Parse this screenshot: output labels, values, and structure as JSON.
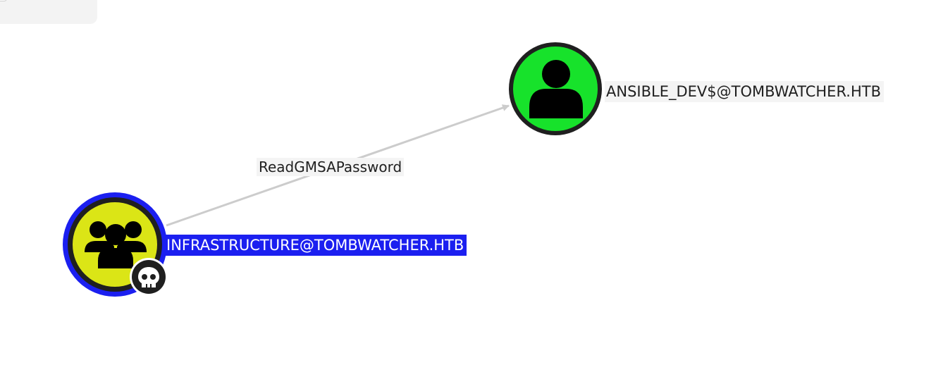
{
  "graph": {
    "edges": [
      {
        "label": "ReadGMSAPassword",
        "source": "INFRASTRUCTURE@TOMBWATCHER.HTB",
        "target": "ANSIBLE_DEV$@TOMBWATCHER.HTB",
        "color": "#cccccc"
      }
    ],
    "nodes": [
      {
        "label": "ANSIBLE_DEV$@TOMBWATCHER.HTB",
        "kind": "user",
        "icon": "user-icon",
        "fill_color": "#17e22b",
        "ring_color": "#1f1f1f",
        "selected": false
      },
      {
        "label": "INFRASTRUCTURE@TOMBWATCHER.HTB",
        "kind": "group",
        "icon": "group-icon",
        "badge_icon": "skull-icon",
        "fill_color": "#dbe516",
        "ring_color": "#1f1f1f",
        "selected": true,
        "selection_color": "#1b1ff0"
      }
    ]
  }
}
